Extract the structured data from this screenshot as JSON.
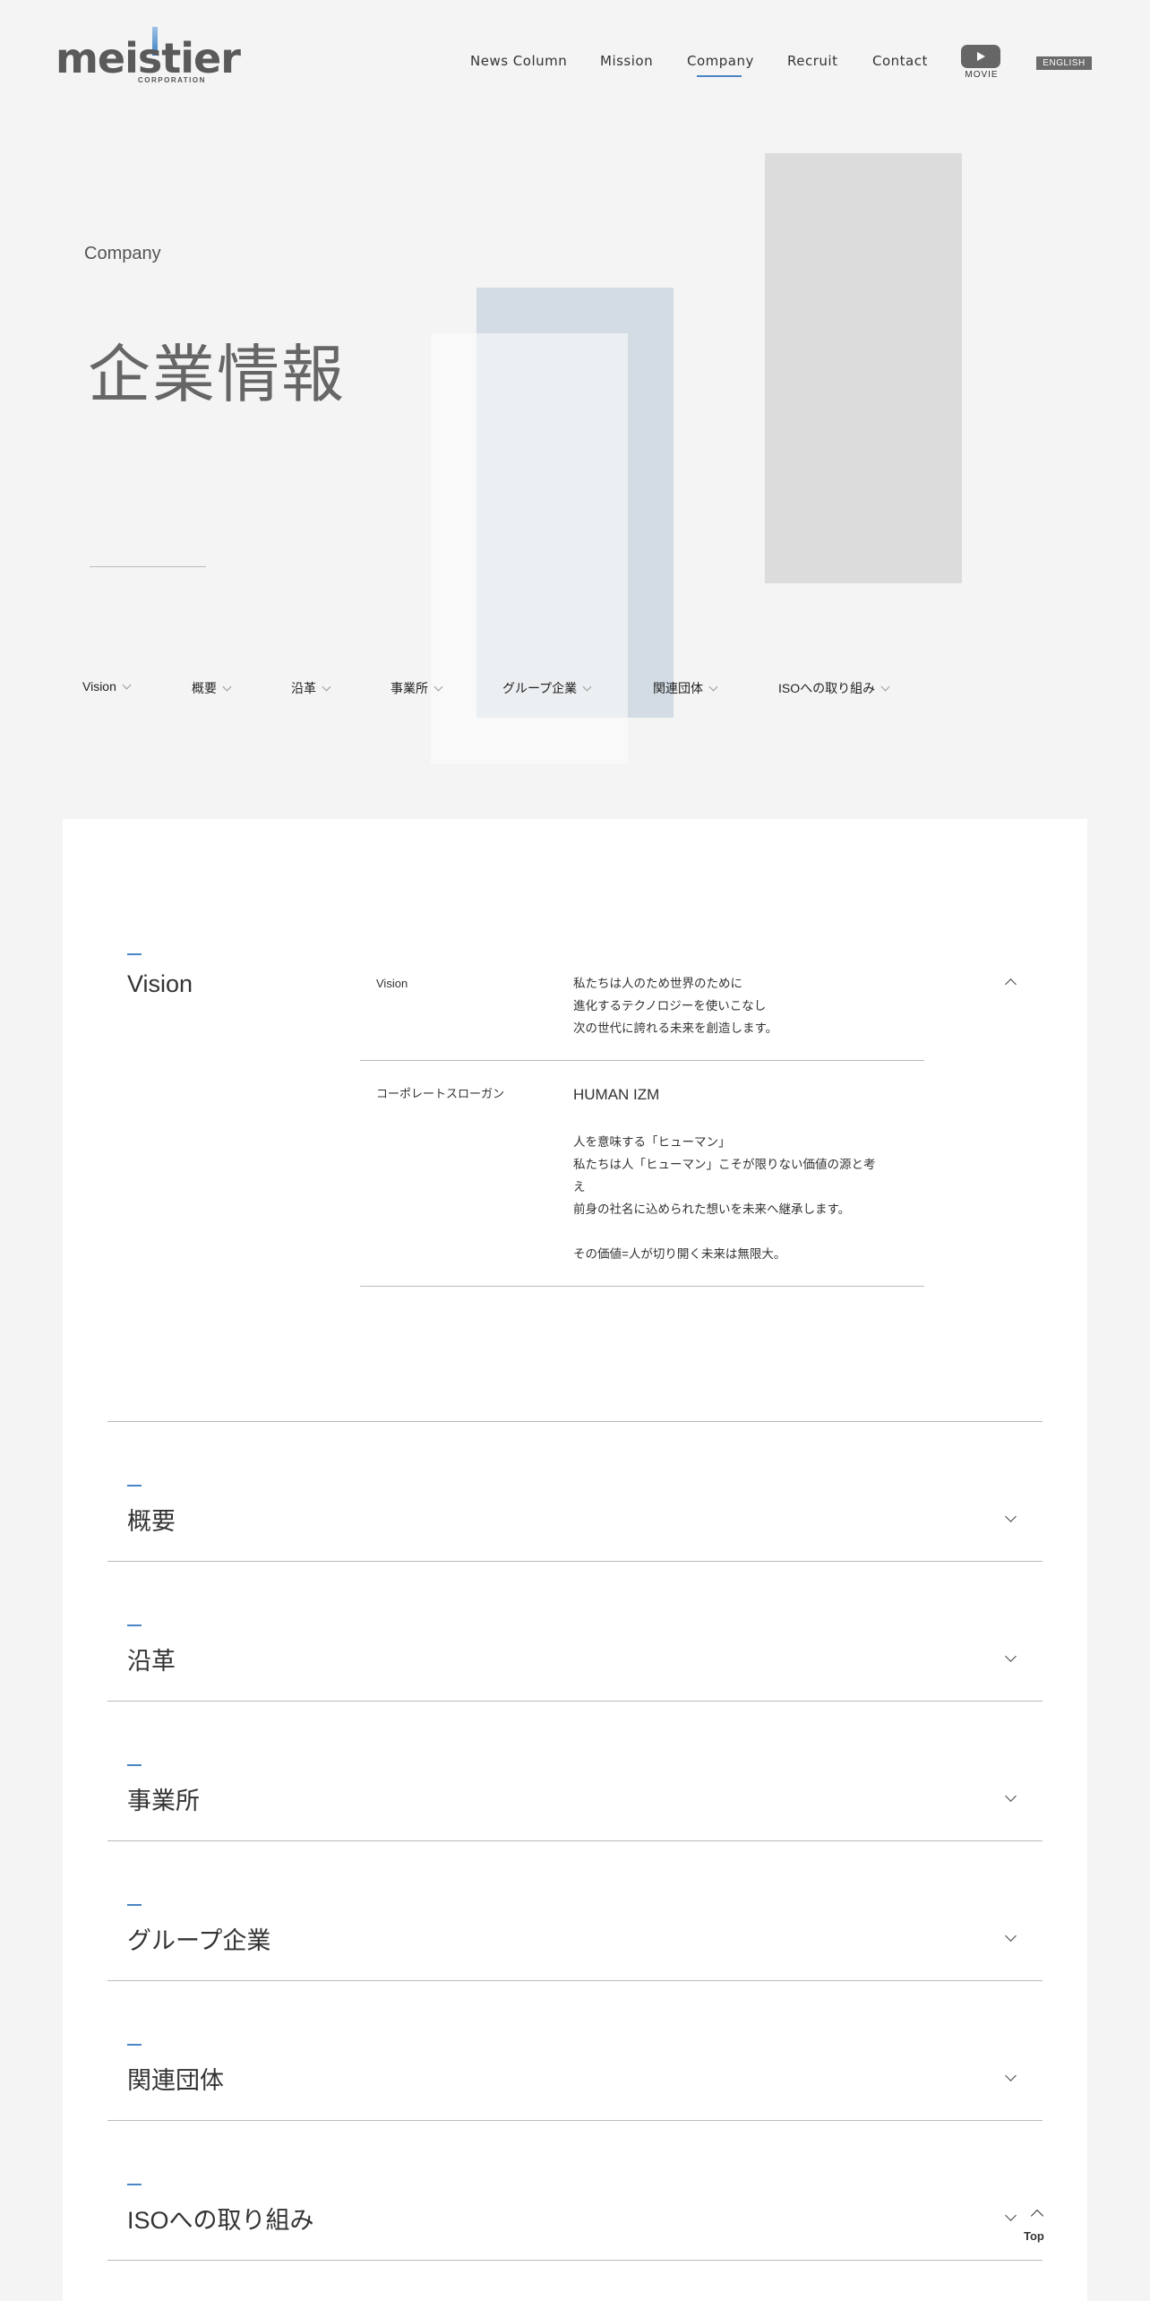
{
  "header": {
    "logo_text": "meistier",
    "logo_sub": "CORPORATION",
    "nav": [
      "News Column",
      "Mission",
      "Company",
      "Recruit",
      "Contact"
    ],
    "active_nav": "Company",
    "movie_label": "MOVIE",
    "english_label": "ENGLISH"
  },
  "hero": {
    "subtitle": "Company",
    "title": "企業情報"
  },
  "anchors": [
    "Vision",
    "概要",
    "沿革",
    "事業所",
    "グループ企業",
    "関連団体",
    "ISOへの取り組み"
  ],
  "vision": {
    "title": "Vision",
    "rows": [
      {
        "label": "Vision",
        "lines": [
          "私たちは人のため世界のために",
          "進化するテクノロジーを使いこなし",
          "次の世代に誇れる未来を創造します。"
        ]
      },
      {
        "label": "コーポレートスローガン",
        "heading": "HUMAN IZM",
        "lines": [
          "人を意味する「ヒューマン」",
          "私たちは人「ヒューマン」こそが限りない価値の源と考",
          "え",
          "前身の社名に込められた想いを未来へ継承します。",
          "",
          "その価値=人が切り開く未来は無限大。"
        ]
      }
    ]
  },
  "sections": [
    "概要",
    "沿革",
    "事業所",
    "グループ企業",
    "関連団体",
    "ISOへの取り組み"
  ],
  "top_button": "Top",
  "colors": {
    "accent": "#4a86c5",
    "page_bg": "#f4f4f4",
    "card_bg": "#ffffff"
  }
}
